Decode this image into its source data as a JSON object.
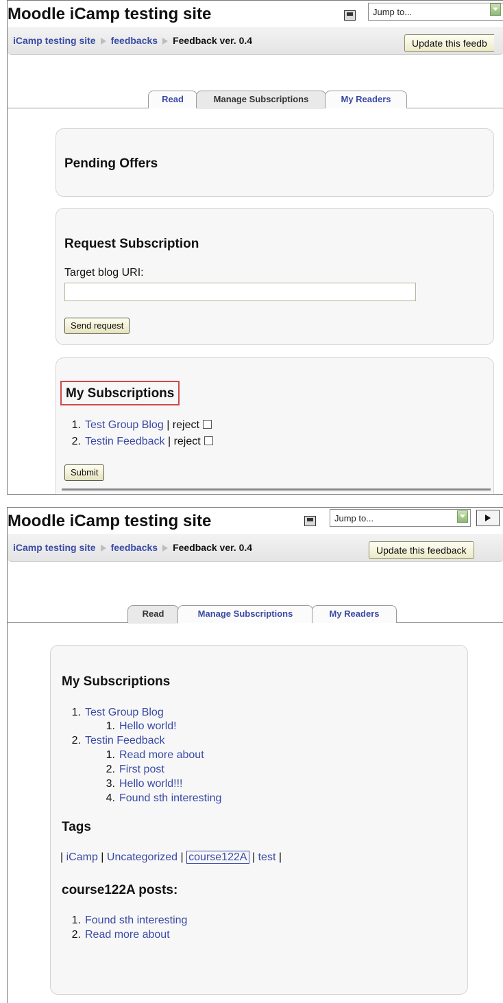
{
  "screen1": {
    "site_title": "Moodle iCamp testing site",
    "jump_placeholder": "Jump to...",
    "breadcrumb": [
      "iCamp testing site",
      "feedbacks",
      "Feedback ver. 0.4"
    ],
    "update_button": "Update this feedb",
    "tabs": [
      "Read",
      "Manage Subscriptions",
      "My Readers"
    ],
    "selected_tab": "Manage Subscriptions",
    "pending": {
      "title": "Pending Offers"
    },
    "request": {
      "title": "Request Subscription",
      "field_label": "Target blog URI:",
      "field_value": "",
      "button": "Send request"
    },
    "subscriptions": {
      "title": "My Subscriptions",
      "items": [
        {
          "num": "1.",
          "name": "Test Group Blog",
          "action": "| reject",
          "checked": false
        },
        {
          "num": "2.",
          "name": "Testin Feedback",
          "action": "| reject",
          "checked": false
        }
      ],
      "submit": "Submit"
    }
  },
  "screen2": {
    "site_title": "Moodle iCamp testing site",
    "jump_placeholder": "Jump to...",
    "breadcrumb": [
      "iCamp testing site",
      "feedbacks",
      "Feedback ver. 0.4"
    ],
    "update_button": "Update this feedback",
    "tabs": [
      "Read",
      "Manage Subscriptions",
      "My Readers"
    ],
    "selected_tab": "Read",
    "subscriptions": {
      "title": "My Subscriptions",
      "blogs": [
        {
          "num": "1.",
          "name": "Test Group Blog",
          "posts": [
            {
              "num": "1.",
              "title": "Hello world!"
            }
          ]
        },
        {
          "num": "2.",
          "name": "Testin Feedback",
          "posts": [
            {
              "num": "1.",
              "title": "Read more about"
            },
            {
              "num": "2.",
              "title": "First post"
            },
            {
              "num": "3.",
              "title": "Hello world!!!"
            },
            {
              "num": "4.",
              "title": "Found sth interesting"
            }
          ]
        }
      ]
    },
    "tags": {
      "title": "Tags",
      "sep": "|",
      "items": [
        "iCamp",
        "Uncategorized",
        "course122A",
        "test"
      ],
      "selected": "course122A"
    },
    "tag_posts": {
      "title": "course122A posts:",
      "items": [
        {
          "num": "1.",
          "title": "Found sth interesting"
        },
        {
          "num": "2.",
          "title": "Read more about"
        }
      ]
    }
  }
}
